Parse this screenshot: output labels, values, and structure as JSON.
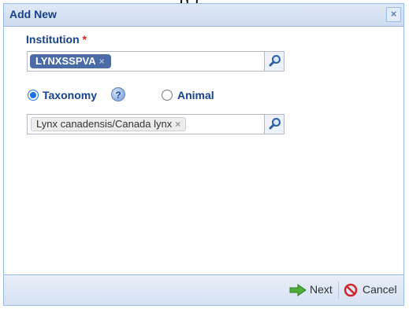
{
  "background": {
    "partial_text": "g    ("
  },
  "dialog": {
    "title": "Add New",
    "close_glyph": "×",
    "institution": {
      "label": "Institution",
      "required_marker": "*",
      "token": "LYNXSSPVA",
      "token_remove": "×",
      "search_icon": "magnifier-icon"
    },
    "mode_options": [
      {
        "label": "Taxonomy",
        "selected": true
      },
      {
        "label": "Animal",
        "selected": false
      }
    ],
    "help_icon": "help-icon",
    "taxonomy": {
      "token": "Lynx canadensis/Canada lynx",
      "token_remove": "×",
      "search_icon": "magnifier-icon"
    },
    "footer": {
      "next_label": "Next",
      "cancel_label": "Cancel"
    }
  },
  "colors": {
    "title_text": "#15428b",
    "border": "#99bbe8",
    "token_dark": "#4a6ba5",
    "radio_selected": "#1a73e8",
    "required": "#e02020"
  }
}
